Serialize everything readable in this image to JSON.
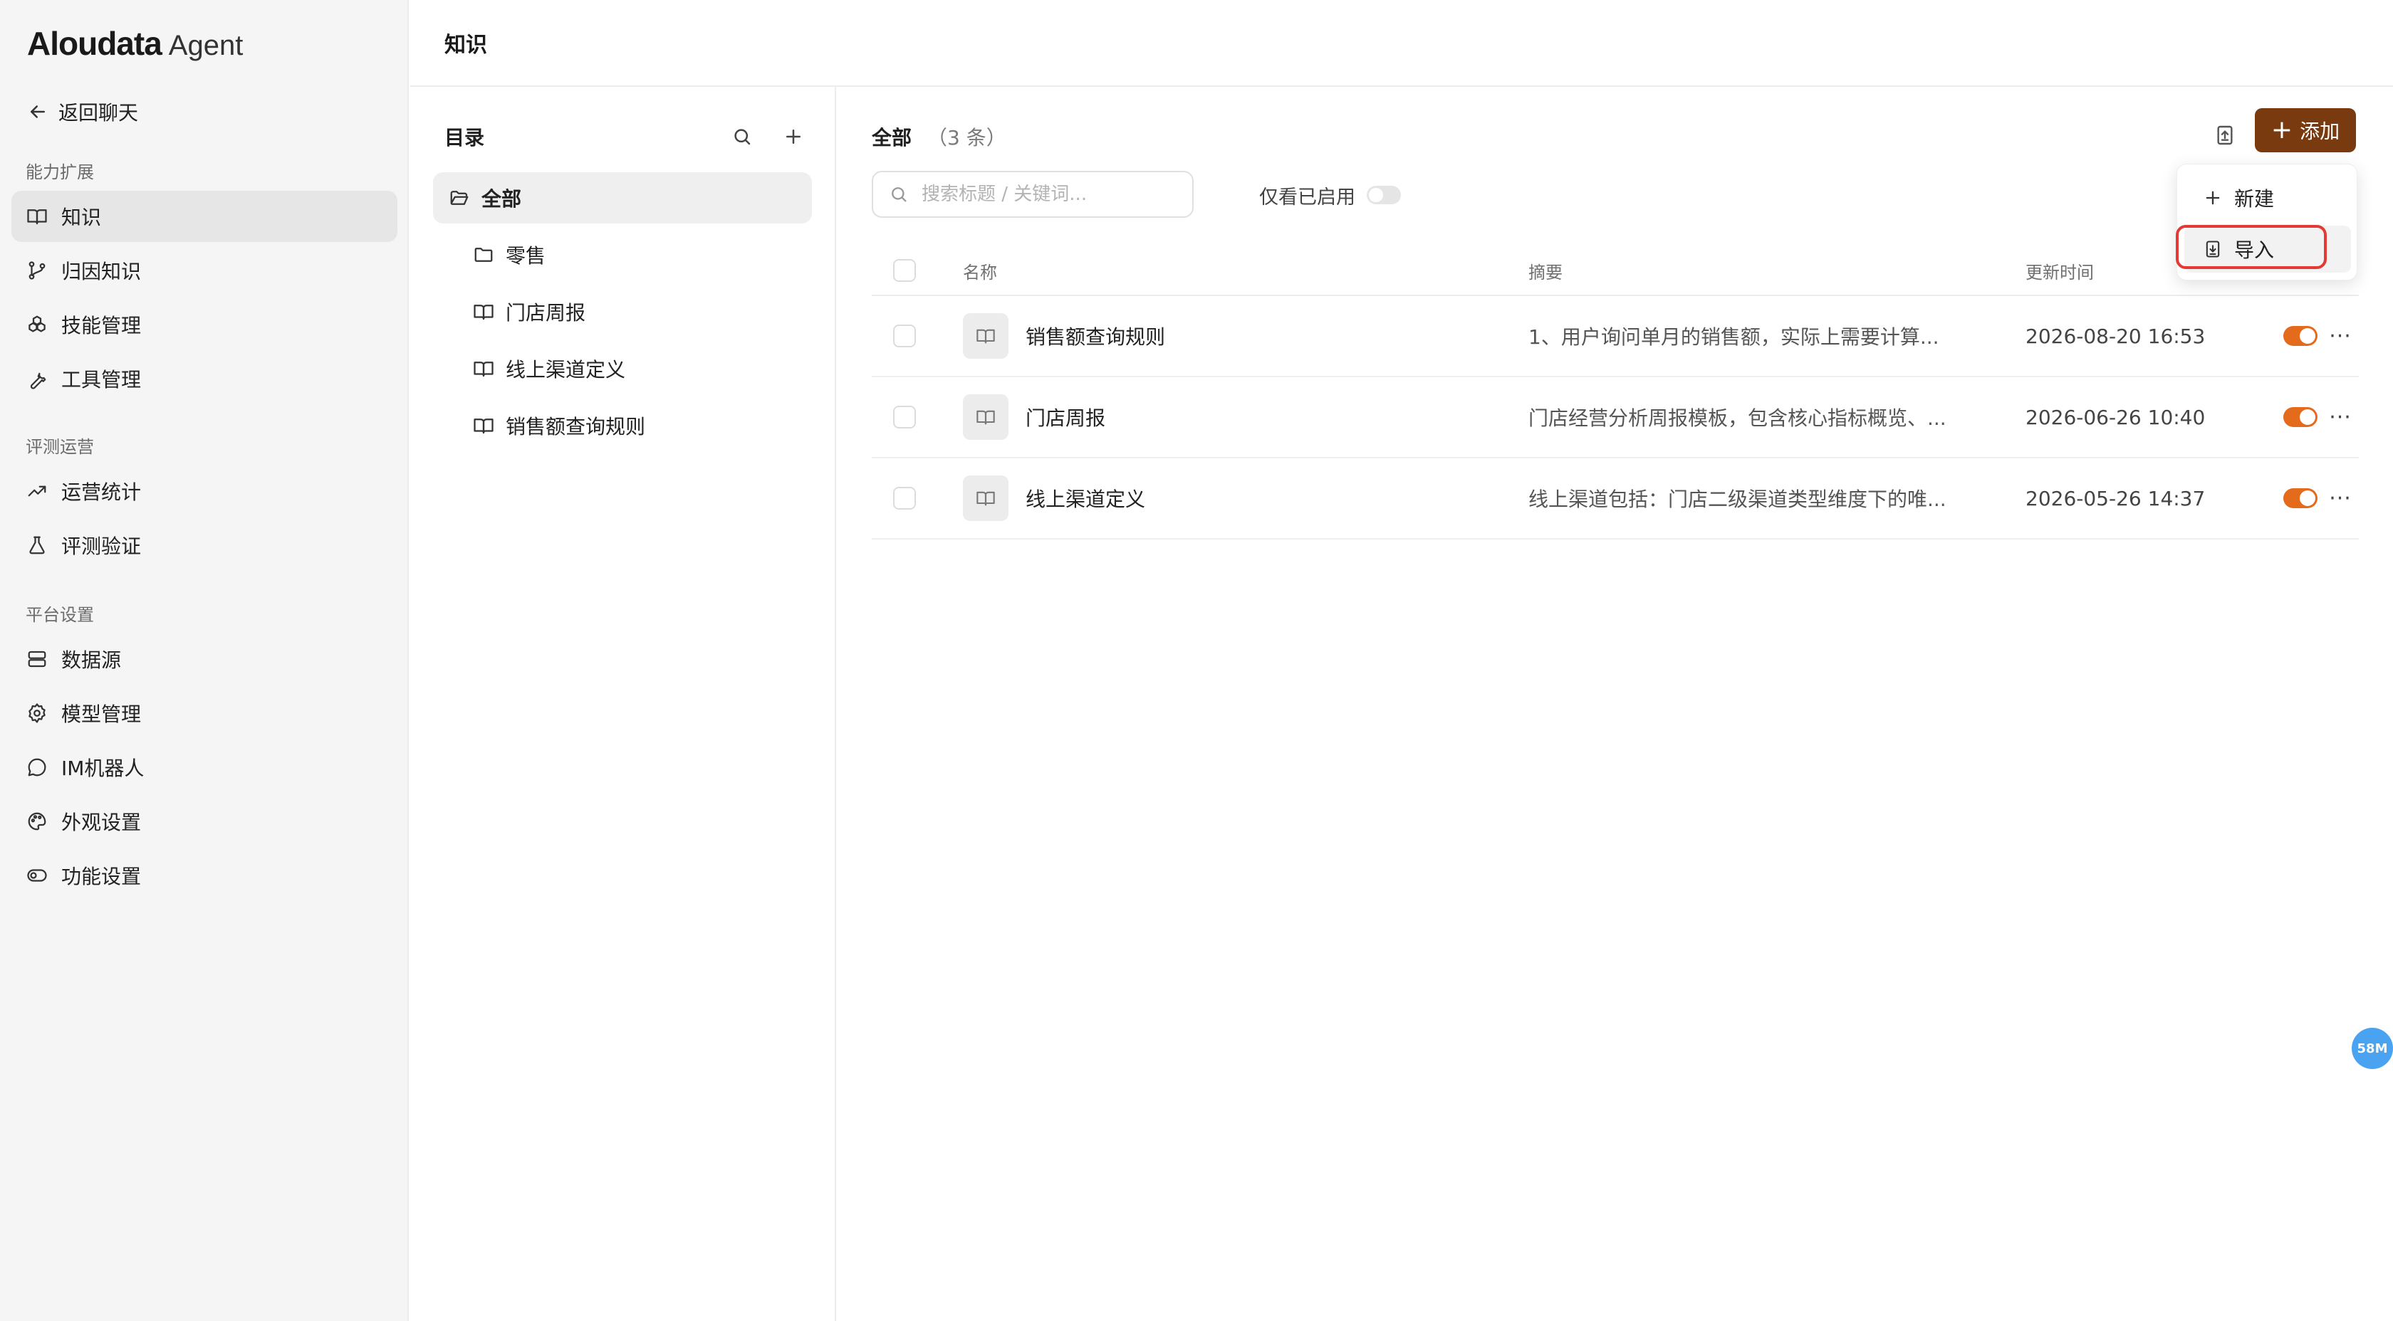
{
  "brand": {
    "name": "Aloudata",
    "suffix": "Agent"
  },
  "sidebar": {
    "back_label": "返回聊天",
    "groups": [
      {
        "title": "能力扩展",
        "items": [
          {
            "label": "知识",
            "icon": "book-icon",
            "active": true
          },
          {
            "label": "归因知识",
            "icon": "git-branch-icon"
          },
          {
            "label": "技能管理",
            "icon": "cubes-icon"
          },
          {
            "label": "工具管理",
            "icon": "wrench-icon"
          }
        ]
      },
      {
        "title": "评测运营",
        "items": [
          {
            "label": "运营统计",
            "icon": "trend-up-icon"
          },
          {
            "label": "评测验证",
            "icon": "flask-icon"
          }
        ]
      },
      {
        "title": "平台设置",
        "items": [
          {
            "label": "数据源",
            "icon": "database-icon"
          },
          {
            "label": "模型管理",
            "icon": "gear-icon"
          },
          {
            "label": "IM机器人",
            "icon": "chat-bubble-icon"
          },
          {
            "label": "外观设置",
            "icon": "palette-icon"
          },
          {
            "label": "功能设置",
            "icon": "toggle-icon"
          }
        ]
      }
    ]
  },
  "header": {
    "title": "知识"
  },
  "directory": {
    "title": "目录",
    "root": "全部",
    "children": [
      {
        "label": "零售",
        "icon": "folder-icon"
      },
      {
        "label": "门店周报",
        "icon": "book-icon"
      },
      {
        "label": "线上渠道定义",
        "icon": "book-icon"
      },
      {
        "label": "销售额查询规则",
        "icon": "book-icon"
      }
    ]
  },
  "list": {
    "title": "全部",
    "count": "（3 条）",
    "add_label": "添加",
    "search_placeholder": "搜索标题 / 关键词...",
    "enabled_only_label": "仅看已启用",
    "columns": {
      "name": "名称",
      "summary": "摘要",
      "updated": "更新时间"
    },
    "rows": [
      {
        "name": "销售额查询规则",
        "summary": "1、用户询问单月的销售额，实际上需要计算...",
        "updated": "2026-08-20 16:53",
        "enabled": true
      },
      {
        "name": "门店周报",
        "summary": "门店经营分析周报模板，包含核心指标概览、...",
        "updated": "2026-06-26 10:40",
        "enabled": true
      },
      {
        "name": "线上渠道定义",
        "summary": "线上渠道包括：门店二级渠道类型维度下的唯...",
        "updated": "2026-05-26 14:37",
        "enabled": true
      }
    ]
  },
  "dropdown": {
    "items": [
      {
        "label": "新建",
        "icon": "plus-icon"
      },
      {
        "label": "导入",
        "icon": "import-icon"
      }
    ]
  },
  "badge": {
    "text": "58M"
  },
  "colors": {
    "accent": "#7a3a0f",
    "switch_on": "#e46a1c",
    "highlight": "#e53935",
    "badge": "#4aa3f0"
  }
}
